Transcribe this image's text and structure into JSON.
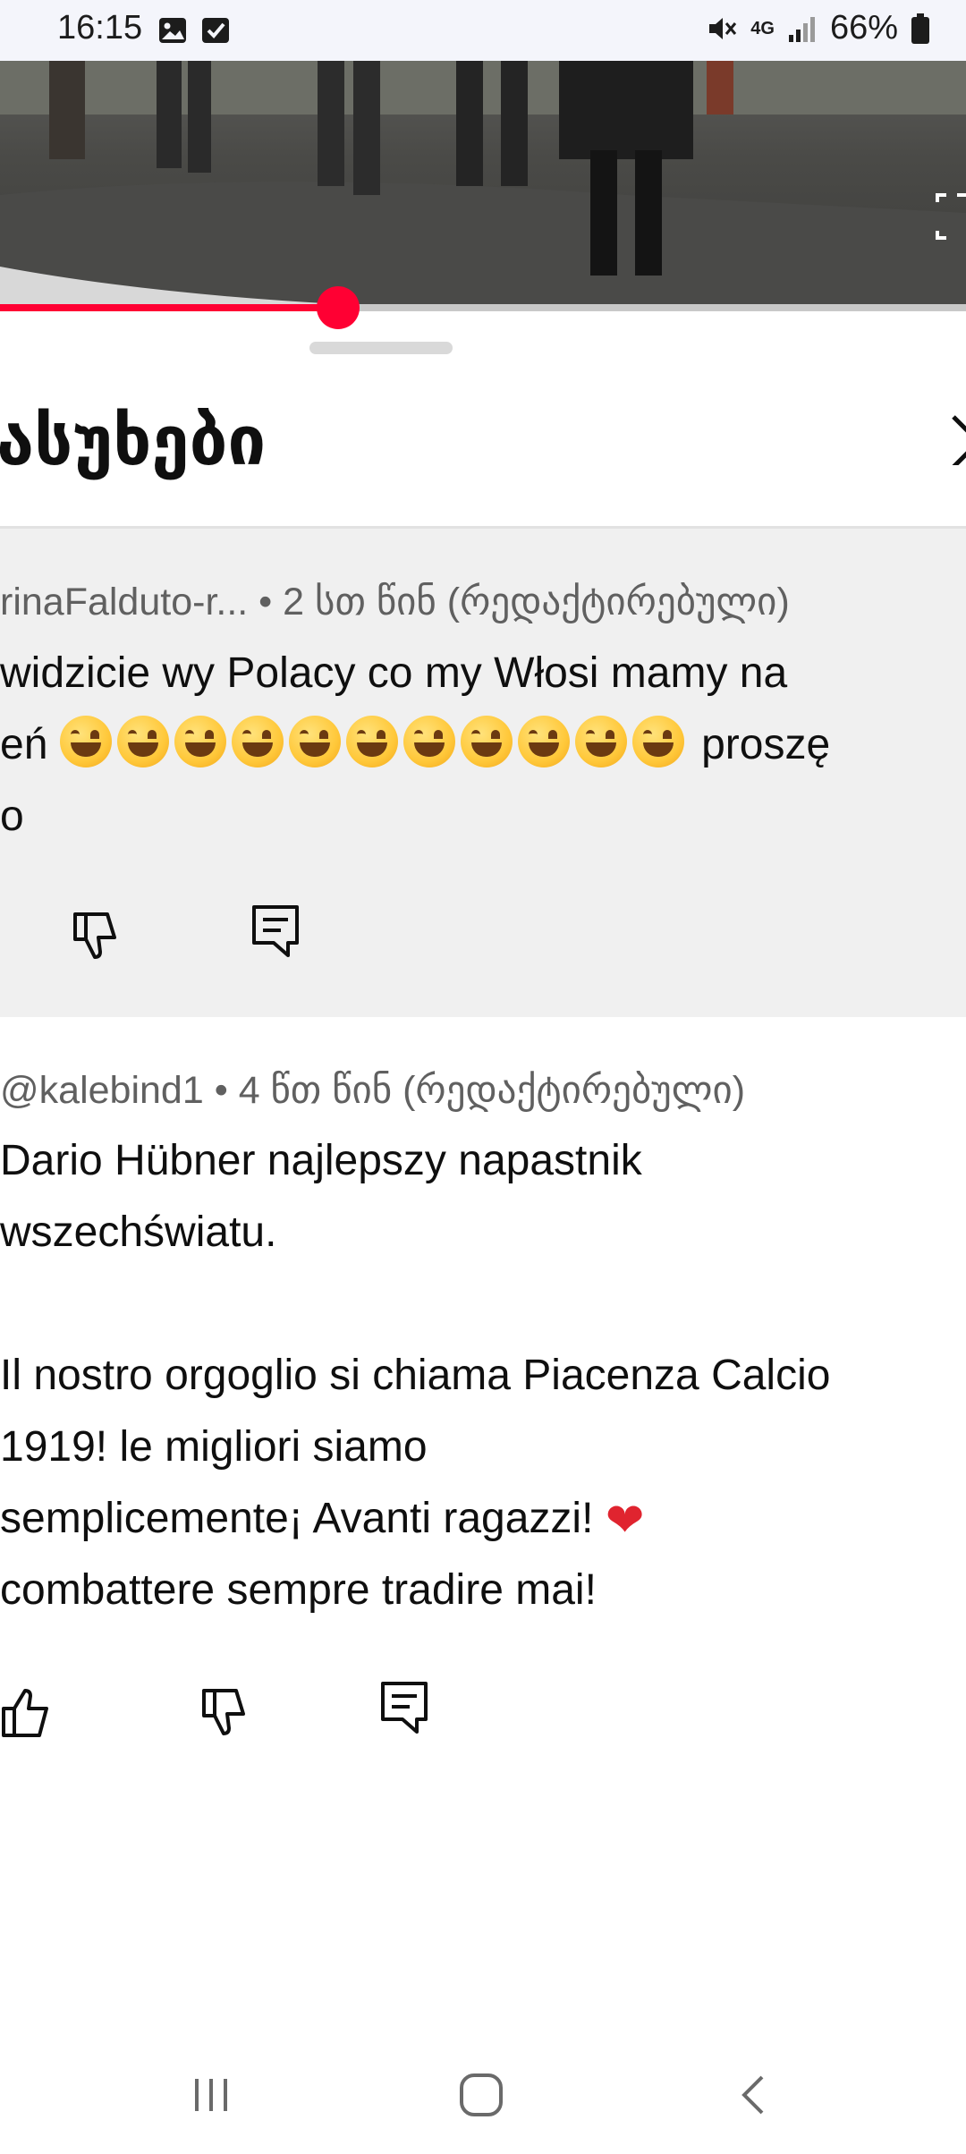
{
  "status_bar": {
    "time": "16:15",
    "battery": "66%",
    "network": "4G",
    "icons": [
      "gallery-icon",
      "checkbox-icon",
      "mute-icon",
      "signal-icon",
      "battery-icon"
    ]
  },
  "video": {
    "progress": 0.35,
    "accent_color": "#ff0033"
  },
  "panel": {
    "title": "ასუხები"
  },
  "comments": [
    {
      "meta": "rinaFalduto-r... • 2 სთ წინ (რედაქტირებული)",
      "line1": "widzicie wy Polacy co my Włosi mamy na",
      "line2_prefix": "eń",
      "line2_suffix": "proszę",
      "line3": "o",
      "emoji_count": 11
    },
    {
      "meta": "@kalebind1 • 4 წთ წინ (რედაქტირებული)",
      "lines": [
        "Dario Hübner najlepszy napastnik",
        "wszechświatu.",
        "",
        "Il nostro orgoglio si chiama Piacenza Calcio",
        "1919! le migliori siamo",
        "semplicemente¡ Avanti ragazzi!",
        "combattere sempre tradire mai!"
      ]
    }
  ]
}
